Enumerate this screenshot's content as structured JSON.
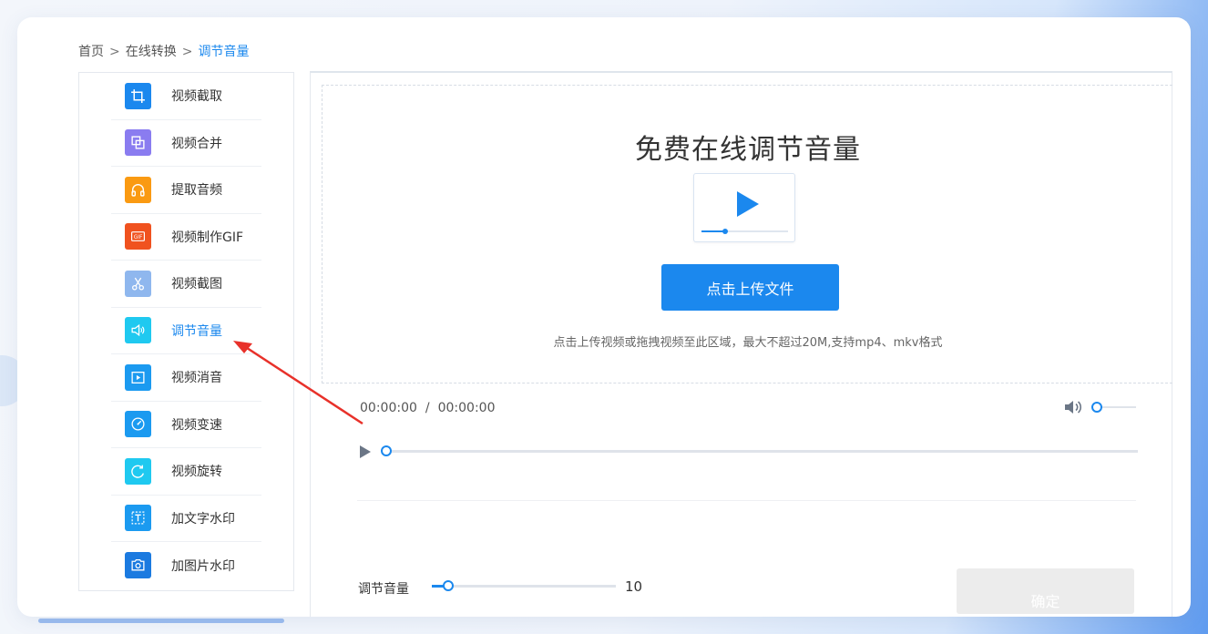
{
  "breadcrumb": {
    "home": "首页",
    "separator": ">",
    "category": "在线转换",
    "current": "调节音量"
  },
  "sidebar": {
    "items": [
      {
        "label": "视频截取",
        "icon": "crop-icon",
        "color": "#1b88ee"
      },
      {
        "label": "视频合并",
        "icon": "merge-icon",
        "color": "#8a7cf0"
      },
      {
        "label": "提取音频",
        "icon": "headphones-icon",
        "color": "#fa9a12"
      },
      {
        "label": "视频制作GIF",
        "icon": "gif-icon",
        "color": "#f0521f"
      },
      {
        "label": "视频截图",
        "icon": "scissors-icon",
        "color": "#8fb7ee"
      },
      {
        "label": "调节音量",
        "icon": "volume-icon",
        "color": "#1fc9f0",
        "active": true
      },
      {
        "label": "视频消音",
        "icon": "video-play-icon",
        "color": "#1b9af0"
      },
      {
        "label": "视频变速",
        "icon": "speedometer-icon",
        "color": "#1b9af0"
      },
      {
        "label": "视频旋转",
        "icon": "rotate-icon",
        "color": "#1fc9f0"
      },
      {
        "label": "加文字水印",
        "icon": "text-watermark-icon",
        "color": "#1b9af0"
      },
      {
        "label": "加图片水印",
        "icon": "image-watermark-icon",
        "color": "#1b7ae0"
      }
    ]
  },
  "upload": {
    "title": "免费在线调节音量",
    "button_label": "点击上传文件",
    "hint": "点击上传视频或拖拽视频至此区域，最大不超过20M,支持mp4、mkv格式"
  },
  "player": {
    "current_time": "00:00:00",
    "separator": "/",
    "total_time": "00:00:00"
  },
  "adjust": {
    "label": "调节音量",
    "value": "10",
    "confirm_label": "确定"
  },
  "colors": {
    "accent": "#1b88ee"
  }
}
